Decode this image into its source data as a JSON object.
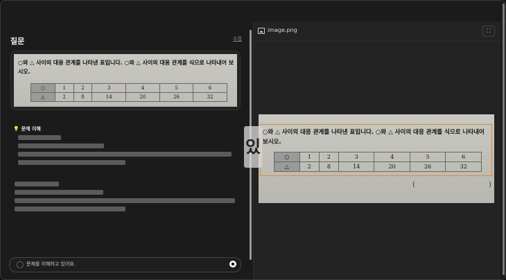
{
  "question_panel": {
    "title": "질문",
    "edit_label": "수정",
    "question_text": "○와 △ 사이의 대응 관계를 나타낸 표입니다. ○와 △ 사이의 대응 관계를 식으로 나타내어 보시오.",
    "table": {
      "row1": [
        "○",
        "1",
        "2",
        "3",
        "4",
        "5",
        "6"
      ],
      "row2": [
        "△",
        "2",
        "8",
        "14",
        "20",
        "26",
        "32"
      ]
    },
    "section_label": "문제 이해",
    "input_status": "문제를 이해하고 있어요."
  },
  "preview_panel": {
    "file_name": "image.png",
    "expand_icon": "expand-icon",
    "question_text": "○와 △ 사이의 대응 관계를 나타낸 표입니다. ○와 △ 사이의 대응 관계를 식으로 나타내어 보시오.",
    "table": {
      "row1": [
        "○",
        "1",
        "2",
        "3",
        "4",
        "5",
        "6"
      ],
      "row2": [
        "△",
        "2",
        "8",
        "14",
        "20",
        "26",
        "32"
      ]
    },
    "paren_open": "(",
    "paren_close": ")",
    "overlay_char": "있"
  },
  "colors": {
    "highlight": "#e5873a",
    "background": "#1b1b1b",
    "skeleton": "#5b5b5b"
  }
}
